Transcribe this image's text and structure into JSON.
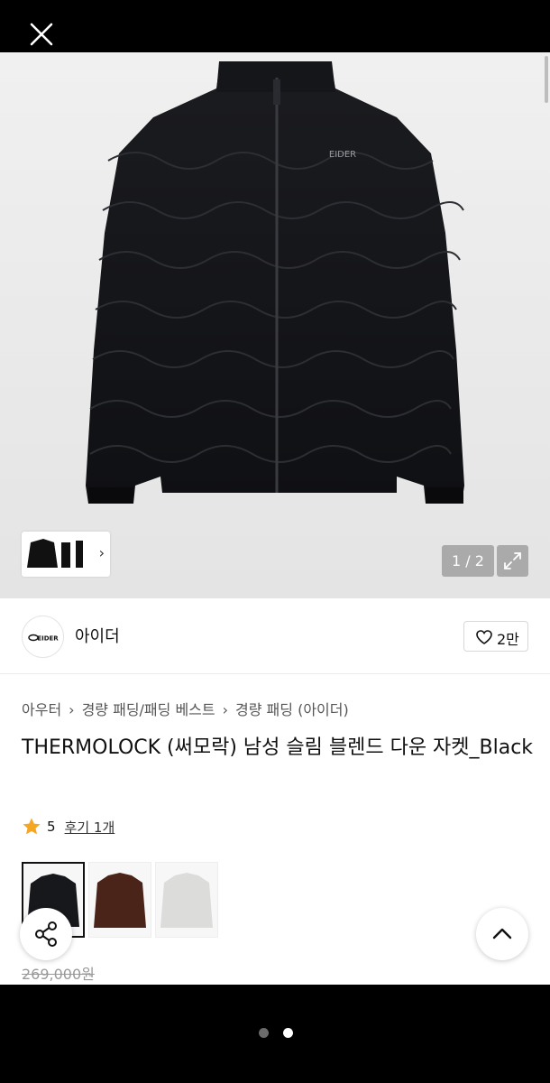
{
  "header": {
    "close_icon": "close-icon"
  },
  "gallery": {
    "counter": "1 / 2",
    "expand_icon": "expand-icon",
    "next_icon": "chevron-right-icon",
    "jacket_logo_text": "EIDER"
  },
  "brand": {
    "logo_text": "EIDER",
    "name": "아이더",
    "like_count": "2만",
    "like_icon": "heart-icon"
  },
  "breadcrumb": [
    "아우터",
    "경량 패딩/패딩 베스트",
    "경량 패딩 (아이더)"
  ],
  "product": {
    "title": "THERMOLOCK (써모락) 남성 슬림 블렌드 다운 자켓_Black",
    "rating": "5",
    "reviews": "후기 1개",
    "original_price": "269,000원"
  },
  "swatches": [
    {
      "color": "#16181c",
      "selected": true
    },
    {
      "color": "#4a2418",
      "selected": false
    },
    {
      "color": "#dcdcda",
      "selected": false
    }
  ],
  "floating": {
    "share_icon": "share-icon",
    "top_icon": "chevron-up-icon"
  },
  "pager": {
    "count": 2,
    "active": 2
  },
  "colors": {
    "background": "#000000",
    "accent_star": "#f5a623"
  }
}
